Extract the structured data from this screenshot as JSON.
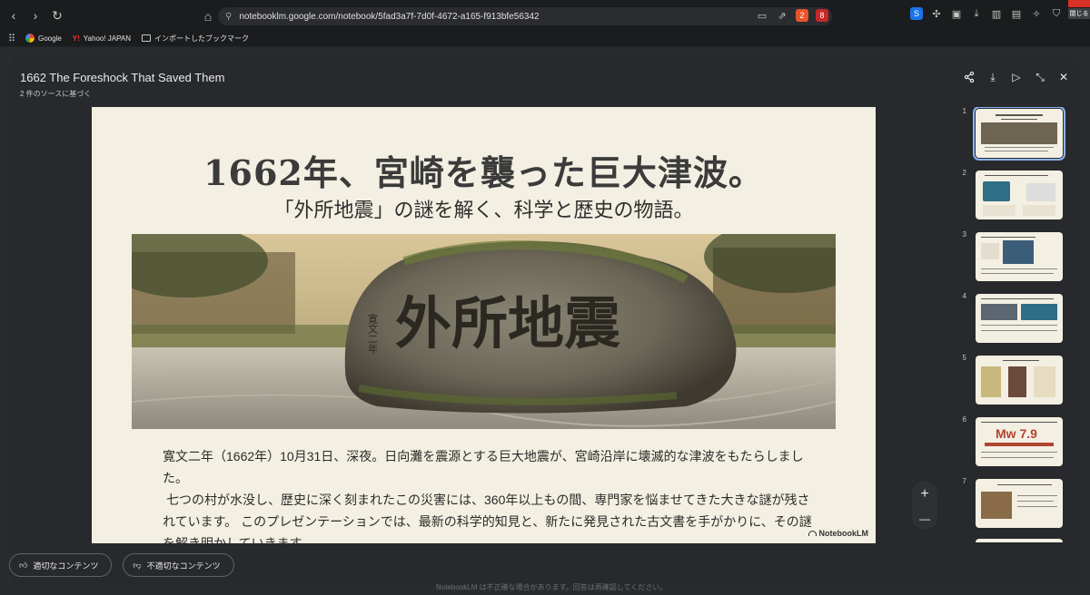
{
  "browser": {
    "url": "notebooklm.google.com/notebook/5fad3a7f-7d0f-4672-a165-f913bfe56342",
    "ext_badges": [
      "2",
      "8"
    ],
    "bookmarks": [
      {
        "label": "Google",
        "icon": "google-icon"
      },
      {
        "label": "Yahoo! JAPAN",
        "icon": "yahoo-icon"
      },
      {
        "label": "インポートしたブックマーク",
        "icon": "folder-icon"
      }
    ],
    "corner_label": "閉じる"
  },
  "dialog": {
    "title": "1662 The Foreshock That Saved Them",
    "subtitle": "2 件のソースに基づく",
    "actions": [
      "share-icon",
      "download-icon",
      "play-icon",
      "collapse-icon",
      "close-icon"
    ]
  },
  "slide": {
    "title": "1662年、宮崎を襲った巨大津波。",
    "subtitle": "「外所地震」の謎を解く、科学と歴史の物語。",
    "stone_text": "外所地震",
    "stone_side_text": "寛文二年",
    "body": [
      "寛文二年（1662年）10月31日、深夜。日向灘を震源とする巨大地震が、宮崎沿岸に壊滅的な津波をもたらしました。",
      "七つの村が水没し、歴史に深く刻まれたこの災害には、360年以上もの間、専門家を悩ませてきた大きな謎が残されています。 このプレゼンテーションでは、最新の科学的知見と、新たに発見された古文書を手がかりに、その謎を解き明かしていきます。"
    ],
    "brand": "NotebookLM"
  },
  "zoom": {
    "in": "+",
    "out": "—"
  },
  "thumbnails": [
    {
      "num": "1",
      "active": true
    },
    {
      "num": "2",
      "active": false
    },
    {
      "num": "3",
      "active": false
    },
    {
      "num": "4",
      "active": false
    },
    {
      "num": "5",
      "active": false
    },
    {
      "num": "6",
      "active": false,
      "label": "Mw 7.9"
    },
    {
      "num": "7",
      "active": false
    }
  ],
  "footer": {
    "good": "適切なコンテンツ",
    "bad": "不適切なコンテンツ",
    "disclaimer": "NotebookLM は不正確な場合があります。回答は再確認してください。"
  }
}
